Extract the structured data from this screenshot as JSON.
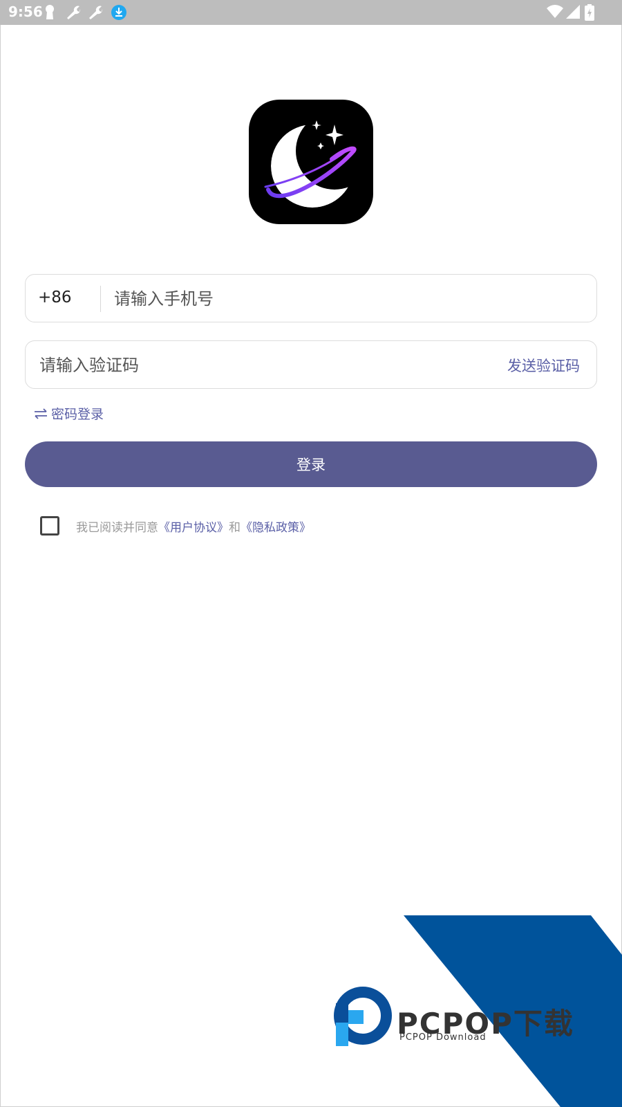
{
  "status_bar": {
    "time": "9:56",
    "icons_left": [
      "keyhole-icon",
      "wrench-icon",
      "wrench-icon",
      "download-badge-icon"
    ],
    "icons_right": [
      "wifi-icon",
      "signal-icon",
      "battery-charging-icon"
    ]
  },
  "login": {
    "country_code": "+86",
    "phone_placeholder": "请输入手机号",
    "code_placeholder": "请输入验证码",
    "send_code_label": "发送验证码",
    "switch_mode_label": "密码登录",
    "login_button_label": "登录",
    "agreement": {
      "prefix": "我已阅读并同意",
      "user_agreement": "《用户协议》",
      "conjunction": "和",
      "privacy_policy": "《隐私政策》"
    }
  },
  "watermark": {
    "brand": "PCPOP下载",
    "subtitle": "PCPOP Download"
  },
  "colors": {
    "accent": "#5a5fa6",
    "button": "#595b91",
    "status_bar": "#bdbdbd",
    "watermark_blue": "#00539b"
  }
}
